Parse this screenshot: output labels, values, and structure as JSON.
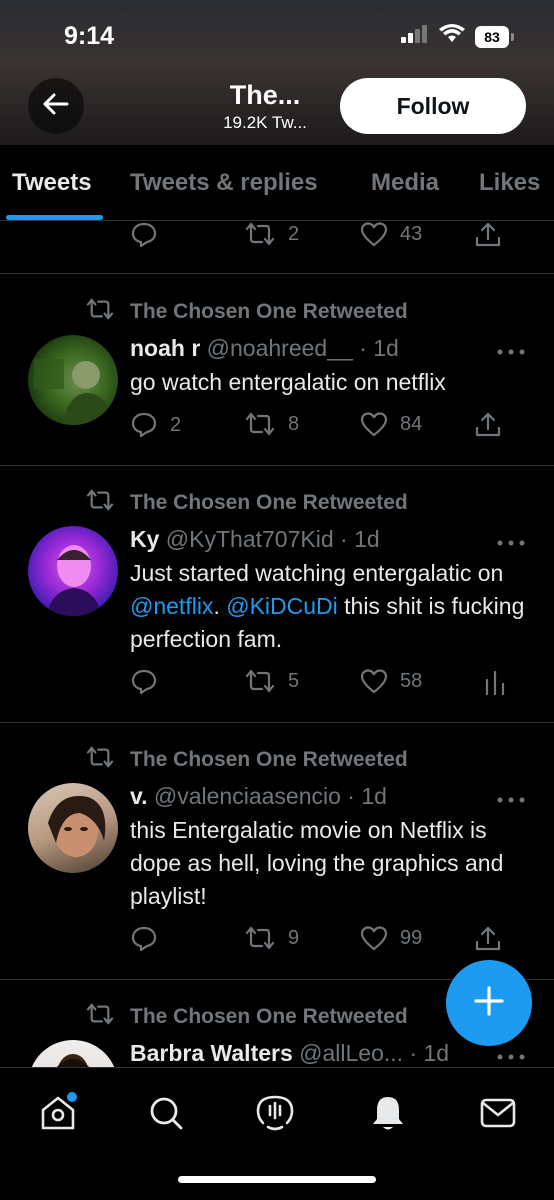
{
  "status_bar": {
    "time": "9:14",
    "battery": "83"
  },
  "header": {
    "name": "The...",
    "count": "19.2K Tw...",
    "follow_label": "Follow"
  },
  "tabs": [
    {
      "label": "Tweets",
      "active": true
    },
    {
      "label": "Tweets & replies",
      "active": false
    },
    {
      "label": "Media",
      "active": false
    },
    {
      "label": "Likes",
      "active": false
    }
  ],
  "top_actions": {
    "replies": "",
    "retweets": "2",
    "likes": "43"
  },
  "tweets": [
    {
      "retweeted_by": "The Chosen One Retweeted",
      "name": "noah r",
      "handle": "@noahreed__",
      "time": "· 1d",
      "text": "go watch entergalatic on netflix",
      "replies": "2",
      "retweets": "8",
      "likes": "84",
      "last_action": "share"
    },
    {
      "retweeted_by": "The Chosen One Retweeted",
      "name": "Ky",
      "handle": "@KyThat707Kid",
      "time": "· 1d",
      "text_parts": [
        "Just started watching entergalatic on ",
        "@netflix",
        ". ",
        "@KiDCuDi",
        " this shit is fucking perfection fam."
      ],
      "replies": "",
      "retweets": "5",
      "likes": "58",
      "last_action": "analytics"
    },
    {
      "retweeted_by": "The Chosen One Retweeted",
      "name": "v.",
      "handle": "@valenciaasencio",
      "time": "· 1d",
      "text": "this Entergalatic movie on Netflix is dope as hell, loving the graphics and playlist!",
      "replies": "",
      "retweets": "9",
      "likes": "99",
      "last_action": "share"
    },
    {
      "retweeted_by": "The Chosen One Retweeted",
      "name": "Barbra Walters",
      "handle": "@allLeo...",
      "time": "· 1d"
    }
  ],
  "icons": {
    "back": "arrow-left-icon",
    "reply": "reply-icon",
    "retweet": "retweet-icon",
    "like": "heart-icon",
    "share": "share-icon",
    "analytics": "analytics-icon",
    "more": "more-icon",
    "compose": "plus-icon",
    "nav": [
      "home-icon",
      "search-icon",
      "spaces-icon",
      "notifications-icon",
      "messages-icon"
    ]
  },
  "colors": {
    "accent": "#1d9bf0",
    "muted": "#71767b",
    "text": "#e7e9ea",
    "background": "#000000"
  }
}
